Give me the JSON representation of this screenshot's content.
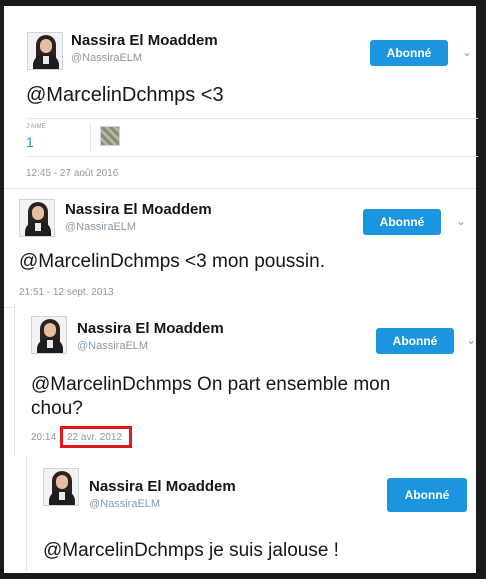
{
  "tweets": [
    {
      "name": "Nassira El Moaddem",
      "handle": "@NassiraELM",
      "follow_label": "Abonné",
      "text": "@MarcelinDchmps <3",
      "likes_label": "J'AIME",
      "likes_count": "1",
      "time": "12:45 - 27 août 2016"
    },
    {
      "name": "Nassira El Moaddem",
      "handle": "@NassiraELM",
      "follow_label": "Abonné",
      "text": "@MarcelinDchmps <3 mon poussin.",
      "time": "21:51 - 12 sept. 2013"
    },
    {
      "name": "Nassira El Moaddem",
      "handle": "@NassiraELM",
      "follow_label": "Abonné",
      "text_line1": "@MarcelinDchmps On part ensemble mon",
      "text_line2": "chou?",
      "time_hour": "20:14",
      "time_date": "22 avr. 2012"
    },
    {
      "name": "Nassira El Moaddem",
      "handle": "@NassiraELM",
      "follow_label": "Abonné",
      "text": "@MarcelinDchmps je suis jalouse !"
    }
  ],
  "icons": {
    "chevron": "chevron-down-icon",
    "avatar": "profile-photo",
    "liker_avatar": "liker-avatar"
  },
  "colors": {
    "follow_button": "#1b95e0",
    "highlight": "#e0161b",
    "meta_text": "#8899a6"
  }
}
